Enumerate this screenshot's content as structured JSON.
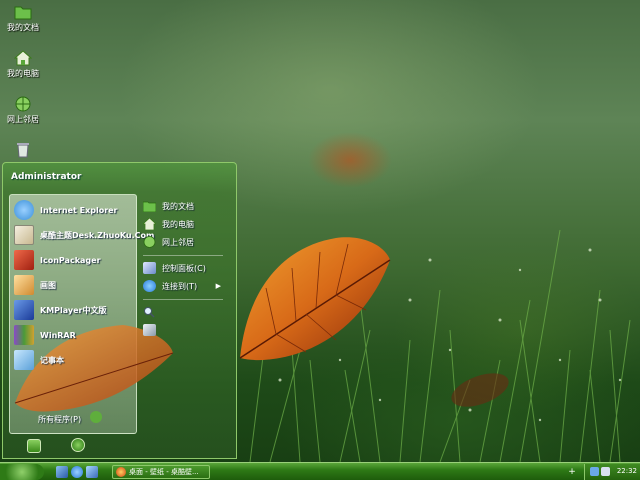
{
  "desktop": {
    "icons": [
      {
        "label": "我的文档",
        "icon": "folder-icon"
      },
      {
        "label": "我的电脑",
        "icon": "computer-icon"
      },
      {
        "label": "网上邻居",
        "icon": "network-icon"
      },
      {
        "label": "",
        "icon": "recycle-bin-icon"
      }
    ]
  },
  "start_menu": {
    "user": "Administrator",
    "programs": [
      {
        "label": "Internet Explorer",
        "icon": "internet-explorer-icon",
        "color": "#3a8fd8"
      },
      {
        "label": "桌酷主题Desk.ZhuoKu.Com",
        "icon": "theme-icon",
        "color": "#d9d2b8"
      },
      {
        "label": "IconPackager",
        "icon": "iconpackager-icon",
        "color": "#c23a2a"
      },
      {
        "label": "画图",
        "icon": "paint-icon",
        "color": "#e8c070"
      },
      {
        "label": "KMPlayer中文版",
        "icon": "kmplayer-icon",
        "color": "#2a5ab8"
      },
      {
        "label": "WinRAR",
        "icon": "winrar-icon",
        "color": "#7a3aa8"
      },
      {
        "label": "记事本",
        "icon": "notepad-icon",
        "color": "#5aa0d8"
      }
    ],
    "all_programs": "所有程序(P)",
    "places": [
      {
        "label": "我的文档",
        "icon": "folder-icon"
      },
      {
        "label": "我的电脑",
        "icon": "computer-icon"
      },
      {
        "label": "网上邻居",
        "icon": "network-icon"
      }
    ],
    "system": [
      {
        "label": "控制面板(C)",
        "icon": "control-panel-icon"
      },
      {
        "label": "连接到(T)",
        "icon": "connect-icon"
      },
      {
        "label": "",
        "icon": "search-icon"
      },
      {
        "label": "",
        "icon": "run-icon"
      }
    ]
  },
  "taskbar": {
    "task_label": "桌面 - 壁纸 - 桌酷壁...",
    "clock": "22:32",
    "tray_toggle": "+",
    "accent": "#2e7a16"
  }
}
